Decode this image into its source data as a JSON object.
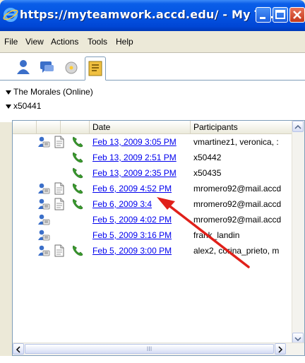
{
  "window": {
    "title": "https://myteamwork.accd.edu/ - My T...",
    "buttons": [
      "minimize",
      "maximize",
      "close"
    ]
  },
  "menu": {
    "items": [
      "File",
      "View",
      "Actions",
      "Tools",
      "Help"
    ]
  },
  "tabs": [
    {
      "icon": "contacts-icon",
      "active": false
    },
    {
      "icon": "chat-icon",
      "active": false
    },
    {
      "icon": "cd-icon",
      "active": false
    },
    {
      "icon": "history-icon",
      "active": true
    }
  ],
  "tree": {
    "group": "The Morales (Online)",
    "subgroup": "x50441"
  },
  "table": {
    "columns": [
      "",
      "",
      "",
      "Date",
      "Participants"
    ],
    "rows": [
      {
        "icons": [
          "contact",
          "document",
          "phone"
        ],
        "date": "Feb 13, 2009 3:05 PM",
        "participants": "vmartinez1, veronica, :"
      },
      {
        "icons": [
          "phone"
        ],
        "date": "Feb 13, 2009 2:51 PM",
        "participants": "x50442"
      },
      {
        "icons": [
          "phone"
        ],
        "date": "Feb 13, 2009 2:35 PM",
        "participants": "x50435"
      },
      {
        "icons": [
          "contact",
          "document",
          "phone"
        ],
        "date": "Feb 6, 2009 4:52 PM",
        "participants": "mromero92@mail.accd"
      },
      {
        "icons": [
          "contact",
          "document",
          "phone"
        ],
        "date": "Feb 6, 2009 3:4",
        "participants": "mromero92@mail.accd"
      },
      {
        "icons": [
          "contact"
        ],
        "date": "Feb 5, 2009 4:02 PM",
        "participants": "mromero92@mail.accd"
      },
      {
        "icons": [
          "contact"
        ],
        "date": "Feb 5, 2009 3:16 PM",
        "participants": "frank_landin"
      },
      {
        "icons": [
          "contact",
          "document",
          "phone"
        ],
        "date": "Feb 5, 2009 3:00 PM",
        "participants": "alex2, corina_prieto, m"
      }
    ]
  },
  "scrollbar": {
    "hscroll_grip": "III"
  },
  "colors": {
    "title_blue": "#0454e2",
    "link": "#0000ee",
    "annotation_arrow": "#e0201a"
  }
}
